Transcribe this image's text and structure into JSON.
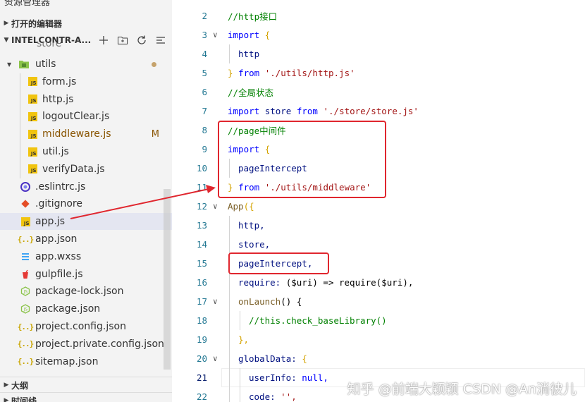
{
  "sidebar": {
    "title": "资源管理器",
    "title_dots": "···",
    "open_editors": "打开的编辑器",
    "project": "INTELCONTR-A...",
    "partial_top": "store",
    "tree": [
      {
        "label": "utils",
        "type": "folder",
        "modified_dot": true
      },
      {
        "label": "form.js",
        "type": "js"
      },
      {
        "label": "http.js",
        "type": "js"
      },
      {
        "label": "logoutClear.js",
        "type": "js"
      },
      {
        "label": "middleware.js",
        "type": "js",
        "badge": "M"
      },
      {
        "label": "util.js",
        "type": "js"
      },
      {
        "label": "verifyData.js",
        "type": "js"
      },
      {
        "label": ".eslintrc.js",
        "type": "eslint"
      },
      {
        "label": ".gitignore",
        "type": "git"
      },
      {
        "label": "app.js",
        "type": "js",
        "selected": true
      },
      {
        "label": "app.json",
        "type": "json"
      },
      {
        "label": "app.wxss",
        "type": "css"
      },
      {
        "label": "gulpfile.js",
        "type": "gulp"
      },
      {
        "label": "package-lock.json",
        "type": "npm"
      },
      {
        "label": "package.json",
        "type": "npm"
      },
      {
        "label": "project.config.json",
        "type": "json"
      },
      {
        "label": "project.private.config.json",
        "type": "json"
      },
      {
        "label": "sitemap.json",
        "type": "json"
      }
    ],
    "outline": "大纲",
    "timeline": "时间线"
  },
  "editor": {
    "lines": [
      {
        "n": "2",
        "comment": "//http接口"
      },
      {
        "n": "3",
        "kw": "import",
        "brace": "{",
        "fold": true
      },
      {
        "n": "4",
        "id": "http"
      },
      {
        "n": "5",
        "close": "}",
        "from": "from",
        "str": "'./utils/http.js'"
      },
      {
        "n": "6",
        "comment": "//全局状态"
      },
      {
        "n": "7",
        "kw": "import",
        "id": "store",
        "from": "from",
        "str": "'./store/store.js'"
      },
      {
        "n": "8",
        "comment": "//page中间件"
      },
      {
        "n": "9",
        "kw": "import",
        "brace": "{"
      },
      {
        "n": "10",
        "id": "pageIntercept"
      },
      {
        "n": "11",
        "close": "}",
        "from": "from",
        "str": "'./utils/middleware'"
      },
      {
        "n": "12",
        "fn": "App",
        "paren": "({",
        "fold": true
      },
      {
        "n": "13",
        "id": "http,"
      },
      {
        "n": "14",
        "id": "store,"
      },
      {
        "n": "15",
        "id": "pageIntercept,"
      },
      {
        "n": "16",
        "id": "require:",
        "rest": "($uri) => require($uri),"
      },
      {
        "n": "17",
        "fn": "onLaunch",
        "rest": "() {",
        "fold": true
      },
      {
        "n": "18",
        "comment": "//this.check_baseLibrary()"
      },
      {
        "n": "19",
        "close": "},"
      },
      {
        "n": "20",
        "id": "globalData:",
        "brace": "{",
        "fold": true
      },
      {
        "n": "21",
        "id": "userInfo:",
        "kwval": "null,"
      },
      {
        "n": "22",
        "id": "code:",
        "str": "'',"
      }
    ]
  },
  "watermark": "知乎 @前端大颖颖  CSDN @An淌彼儿",
  "colors": {
    "highlight_box": "#e0262e",
    "selected_row": "#e4e6f1",
    "sidebar_bg": "#f3f3f3"
  }
}
